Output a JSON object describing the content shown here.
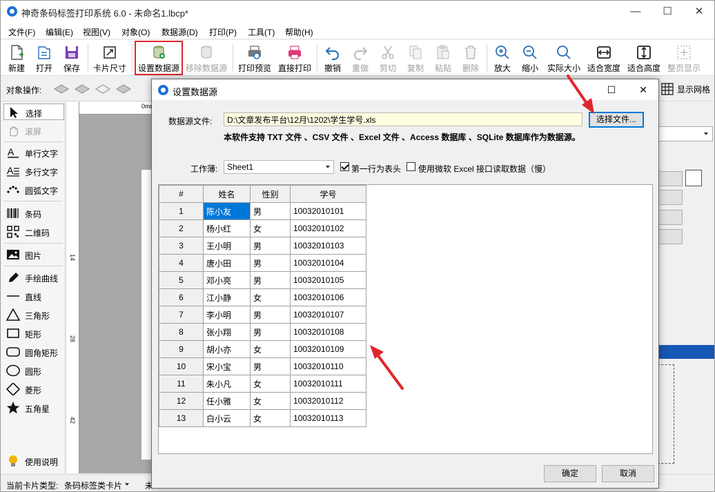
{
  "app": {
    "title": "神奇条码标签打印系统 6.0 - 未命名1.lbcp*",
    "win_min": "—",
    "win_max": "☐",
    "win_close": "✕",
    "icon": "app-logo-icon"
  },
  "menu": [
    "文件(F)",
    "编辑(E)",
    "视图(V)",
    "对象(O)",
    "数据源(D)",
    "打印(P)",
    "工具(T)",
    "帮助(H)"
  ],
  "toolbar": {
    "new": "新建",
    "open": "打开",
    "save": "保存",
    "card_size": "卡片尺寸",
    "set_datasource": "设置数据源",
    "remove_datasource": "移除数据源",
    "print_preview": "打印预览",
    "direct_print": "直接打印",
    "undo": "撤销",
    "redo": "重做",
    "cut": "剪切",
    "copy": "复制",
    "paste": "粘贴",
    "delete": "删除",
    "zoom_in": "放大",
    "zoom_out": "缩小",
    "actual_size": "实际大小",
    "fit_width": "适合宽度",
    "fit_height": "适合高度",
    "full_page": "整页显示"
  },
  "objbar": {
    "label": "对象操作:",
    "show_grid": "显示网格"
  },
  "tools": {
    "select": "选择",
    "scroll": "滚屏",
    "single_text": "单行文字",
    "multi_text": "多行文字",
    "arc_text": "圆弧文字",
    "barcode": "条码",
    "qrcode": "二维码",
    "image": "图片",
    "freehand": "手绘曲线",
    "line": "直线",
    "triangle": "三角形",
    "rect": "矩形",
    "round_rect": "圆角矩形",
    "circle": "圆形",
    "diamond": "菱形",
    "star": "五角星",
    "help": "使用说明"
  },
  "ruler": {
    "marks": [
      "0mm",
      "14",
      "28",
      "42"
    ]
  },
  "status": {
    "card_type_label": "当前卡片类型:",
    "card_type_value": "条码标签类卡片",
    "extra": "未"
  },
  "dialog": {
    "title": "设置数据源",
    "file_label": "数据源文件:",
    "file_path": "D:\\文章发布平台\\12月\\1202\\学生学号.xls",
    "choose_file": "选择文件...",
    "note": "本软件支持 TXT 文件 、CSV 文件 、Excel 文件 、Access 数据库 、SQLite 数据库作为数据源。",
    "sheet_label": "工作薄:",
    "sheet_value": "Sheet1",
    "first_row_header": "第一行为表头",
    "first_row_checked": true,
    "use_ms_excel": "使用微软 Excel 接口读取数据（慢）",
    "use_ms_checked": false,
    "ok": "确定",
    "cancel": "取消",
    "columns": [
      "#",
      "姓名",
      "性别",
      "学号"
    ],
    "rows": [
      [
        "1",
        "陈小友",
        "男",
        "10032010101"
      ],
      [
        "2",
        "杨小红",
        "女",
        "10032010102"
      ],
      [
        "3",
        "王小明",
        "男",
        "10032010103"
      ],
      [
        "4",
        "唐小田",
        "男",
        "10032010104"
      ],
      [
        "5",
        "邓小亮",
        "男",
        "10032010105"
      ],
      [
        "6",
        "江小静",
        "女",
        "10032010106"
      ],
      [
        "7",
        "李小明",
        "男",
        "10032010107"
      ],
      [
        "8",
        "张小翔",
        "男",
        "10032010108"
      ],
      [
        "9",
        "胡小亦",
        "女",
        "10032010109"
      ],
      [
        "10",
        "宋小宝",
        "男",
        "10032010110"
      ],
      [
        "11",
        "朱小凡",
        "女",
        "10032010111"
      ],
      [
        "12",
        "任小雅",
        "女",
        "10032010112"
      ],
      [
        "13",
        "白小云",
        "女",
        "10032010113"
      ]
    ]
  },
  "colors": {
    "accent": "#0078d7",
    "highlight": "#e0262d",
    "file_bg": "#fffde0"
  }
}
